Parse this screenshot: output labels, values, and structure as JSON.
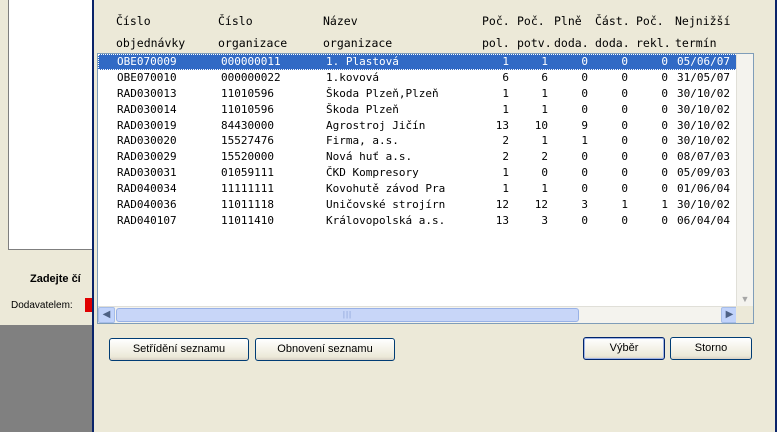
{
  "background_window": {
    "prompt_label": "Zadejte čí",
    "supplier_label": "Dodavatelem:"
  },
  "columns": [
    {
      "line1": "Číslo",
      "line2": "objednávky"
    },
    {
      "line1": "Číslo",
      "line2": "organizace"
    },
    {
      "line1": "Název",
      "line2": "organizace"
    },
    {
      "line1": "Poč.",
      "line2": "pol."
    },
    {
      "line1": "Poč.",
      "line2": "potv."
    },
    {
      "line1": "Plně",
      "line2": "doda."
    },
    {
      "line1": "Část.",
      "line2": "doda."
    },
    {
      "line1": "Poč.",
      "line2": "rekl."
    },
    {
      "line1": "Nejnižší",
      "line2": "termín"
    }
  ],
  "rows": [
    {
      "order": "OBE070009",
      "org_no": "000000011",
      "org_name": "1. Plastová",
      "items": "1",
      "confirmed": "1",
      "full": "0",
      "partial": "0",
      "claims": "0",
      "term": "05/06/07"
    },
    {
      "order": "OBE070010",
      "org_no": "000000022",
      "org_name": "1.kovová",
      "items": "6",
      "confirmed": "6",
      "full": "0",
      "partial": "0",
      "claims": "0",
      "term": "31/05/07"
    },
    {
      "order": "RAD030013",
      "org_no": "11010596",
      "org_name": "Škoda Plzeň,Plzeň",
      "items": "1",
      "confirmed": "1",
      "full": "0",
      "partial": "0",
      "claims": "0",
      "term": "30/10/02"
    },
    {
      "order": "RAD030014",
      "org_no": "11010596",
      "org_name": "Škoda Plzeň",
      "items": "1",
      "confirmed": "1",
      "full": "0",
      "partial": "0",
      "claims": "0",
      "term": "30/10/02"
    },
    {
      "order": "RAD030019",
      "org_no": "84430000",
      "org_name": "Agrostroj Jičín",
      "items": "13",
      "confirmed": "10",
      "full": "9",
      "partial": "0",
      "claims": "0",
      "term": "30/10/02"
    },
    {
      "order": "RAD030020",
      "org_no": "15527476",
      "org_name": "Firma, a.s.",
      "items": "2",
      "confirmed": "1",
      "full": "1",
      "partial": "0",
      "claims": "0",
      "term": "30/10/02"
    },
    {
      "order": "RAD030029",
      "org_no": "15520000",
      "org_name": "Nová huť a.s.",
      "items": "2",
      "confirmed": "2",
      "full": "0",
      "partial": "0",
      "claims": "0",
      "term": "08/07/03"
    },
    {
      "order": "RAD030031",
      "org_no": "01059111",
      "org_name": "ČKD Kompresory",
      "items": "1",
      "confirmed": "0",
      "full": "0",
      "partial": "0",
      "claims": "0",
      "term": "05/09/03"
    },
    {
      "order": "RAD040034",
      "org_no": "11111111",
      "org_name": "Kovohutě závod Pra",
      "items": "1",
      "confirmed": "1",
      "full": "0",
      "partial": "0",
      "claims": "0",
      "term": "01/06/04"
    },
    {
      "order": "RAD040036",
      "org_no": "11011118",
      "org_name": "Uničovské strojírn",
      "items": "12",
      "confirmed": "12",
      "full": "3",
      "partial": "1",
      "claims": "1",
      "term": "30/10/02"
    },
    {
      "order": "RAD040107",
      "org_no": "11011410",
      "org_name": "Královopolská a.s.",
      "items": "13",
      "confirmed": "3",
      "full": "0",
      "partial": "0",
      "claims": "0",
      "term": "06/04/04"
    }
  ],
  "selected_row": 0,
  "buttons": {
    "sort": "Setřídění seznamu",
    "refresh": "Obnovení seznamu",
    "select": "Výběr",
    "cancel": "Storno"
  },
  "icons": {
    "scroll_left": "chevron-left-icon",
    "scroll_right": "chevron-right-icon",
    "scroll_down": "chevron-down-icon",
    "thumb_grip": "grip-icon"
  }
}
